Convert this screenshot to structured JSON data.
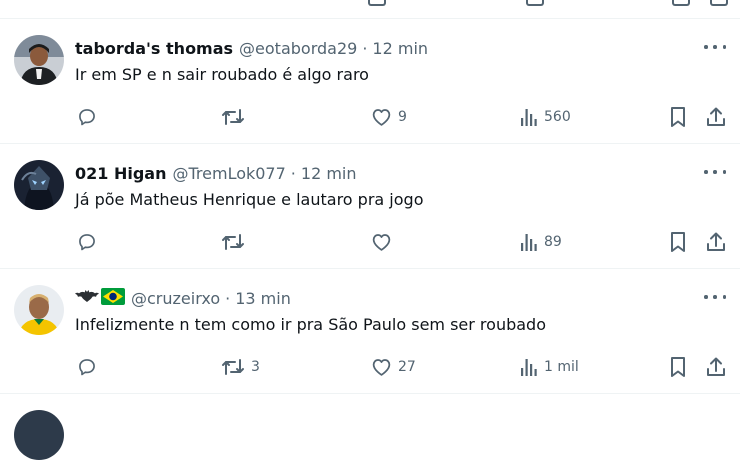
{
  "tweets": [
    {
      "name": "taborda's thomas",
      "handle": "@eotaborda29",
      "time": "12 min",
      "text": "Ir em SP e n sair roubado é algo raro",
      "reply_count": "",
      "retweet_count": "",
      "like_count": "9",
      "view_count": "560"
    },
    {
      "name": "021 Higan",
      "handle": "@TremLok077",
      "time": "12 min",
      "text": "Já põe Matheus Henrique e lautaro pra jogo",
      "reply_count": "",
      "retweet_count": "",
      "like_count": "",
      "view_count": "89"
    },
    {
      "name": "",
      "handle": "@cruzeirxo",
      "time": "13 min",
      "text": "Infelizmente n tem como ir pra São Paulo sem ser roubado",
      "reply_count": "",
      "retweet_count": "3",
      "like_count": "27",
      "view_count": "1 mil"
    }
  ],
  "separator": "·",
  "icons": {
    "reply": "reply-icon",
    "retweet": "retweet-icon",
    "like": "heart-icon",
    "views": "views-icon",
    "bookmark": "bookmark-icon",
    "share": "share-icon",
    "more": "more-icon",
    "name_emojis": [
      "bat-emoji-icon",
      "brazil-flag-icon"
    ]
  },
  "colors": {
    "text": "#0f1419",
    "secondary": "#536471",
    "divider": "#eff3f4",
    "brazil_green": "#009c3b",
    "brazil_yellow": "#ffdf00"
  }
}
